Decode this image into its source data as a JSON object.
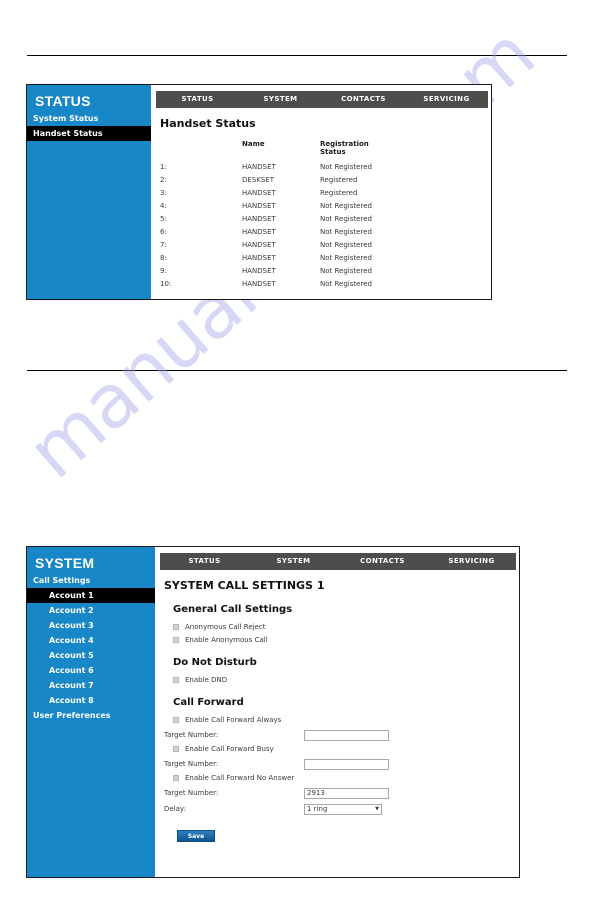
{
  "watermark": {
    "text": "manualshive.com"
  },
  "panel_status": {
    "sidebar": {
      "title": "STATUS",
      "items": [
        {
          "label": "System Status",
          "selected": false,
          "type": "group"
        },
        {
          "label": "Handset Status",
          "selected": true,
          "type": "group"
        }
      ]
    },
    "nav_tabs": [
      {
        "label": "STATUS",
        "active": true
      },
      {
        "label": "SYSTEM",
        "active": false
      },
      {
        "label": "CONTACTS",
        "active": false
      },
      {
        "label": "SERVICING",
        "active": false
      }
    ],
    "heading": "Handset Status",
    "table": {
      "columns": [
        "",
        "Name",
        "Registration Status"
      ],
      "column_registration_line1": "Registration",
      "column_registration_line2": "Status",
      "column_name": "Name",
      "rows": [
        {
          "index": "1:",
          "name": "HANDSET",
          "registration": "Not Registered"
        },
        {
          "index": "2:",
          "name": "DESKSET",
          "registration": "Registered"
        },
        {
          "index": "3:",
          "name": "HANDSET",
          "registration": "Registered"
        },
        {
          "index": "4:",
          "name": "HANDSET",
          "registration": "Not Registered"
        },
        {
          "index": "5:",
          "name": "HANDSET",
          "registration": "Not Registered"
        },
        {
          "index": "6:",
          "name": "HANDSET",
          "registration": "Not Registered"
        },
        {
          "index": "7:",
          "name": "HANDSET",
          "registration": "Not Registered"
        },
        {
          "index": "8:",
          "name": "HANDSET",
          "registration": "Not Registered"
        },
        {
          "index": "9:",
          "name": "HANDSET",
          "registration": "Not Registered"
        },
        {
          "index": "10:",
          "name": "HANDSET",
          "registration": "Not Registered"
        }
      ]
    }
  },
  "panel_system": {
    "sidebar": {
      "title": "SYSTEM",
      "group_label": "Call Settings",
      "accounts": [
        {
          "label": "Account 1",
          "selected": true
        },
        {
          "label": "Account 2",
          "selected": false
        },
        {
          "label": "Account 3",
          "selected": false
        },
        {
          "label": "Account 4",
          "selected": false
        },
        {
          "label": "Account 5",
          "selected": false
        },
        {
          "label": "Account 6",
          "selected": false
        },
        {
          "label": "Account 7",
          "selected": false
        },
        {
          "label": "Account 8",
          "selected": false
        }
      ],
      "user_preferences_label": "User Preferences"
    },
    "nav_tabs": [
      {
        "label": "STATUS",
        "active": true
      },
      {
        "label": "SYSTEM",
        "active": false
      },
      {
        "label": "CONTACTS",
        "active": false
      },
      {
        "label": "SERVICING",
        "active": false
      }
    ],
    "heading": "SYSTEM CALL SETTINGS 1",
    "general_call_settings": {
      "heading": "General Call Settings",
      "anonymous_call_reject_label": "Anonymous Call Reject",
      "enable_anonymous_call_label": "Enable Anonymous Call"
    },
    "do_not_disturb": {
      "heading": "Do Not Disturb",
      "enable_dnd_label": "Enable DND"
    },
    "call_forward": {
      "heading": "Call Forward",
      "always_label": "Enable Call Forward Always",
      "always_target_label": "Target Number:",
      "always_target_value": "",
      "busy_label": "Enable Call Forward Busy",
      "busy_target_label": "Target Number:",
      "busy_target_value": "",
      "noanswer_label": "Enable Call Forward No Answer",
      "noanswer_target_label": "Target Number:",
      "noanswer_target_value": "2913",
      "delay_label": "Delay:",
      "delay_value": "1 ring",
      "delay_arrow": "▼"
    },
    "save_label": "Save"
  },
  "colors": {
    "sidebar_blue": "#1787c8",
    "navbar_grey": "#4d4d4d",
    "selected_black": "#000000",
    "save_blue": "#1c6aa8",
    "watermark_purple": "#9fa3e8"
  }
}
